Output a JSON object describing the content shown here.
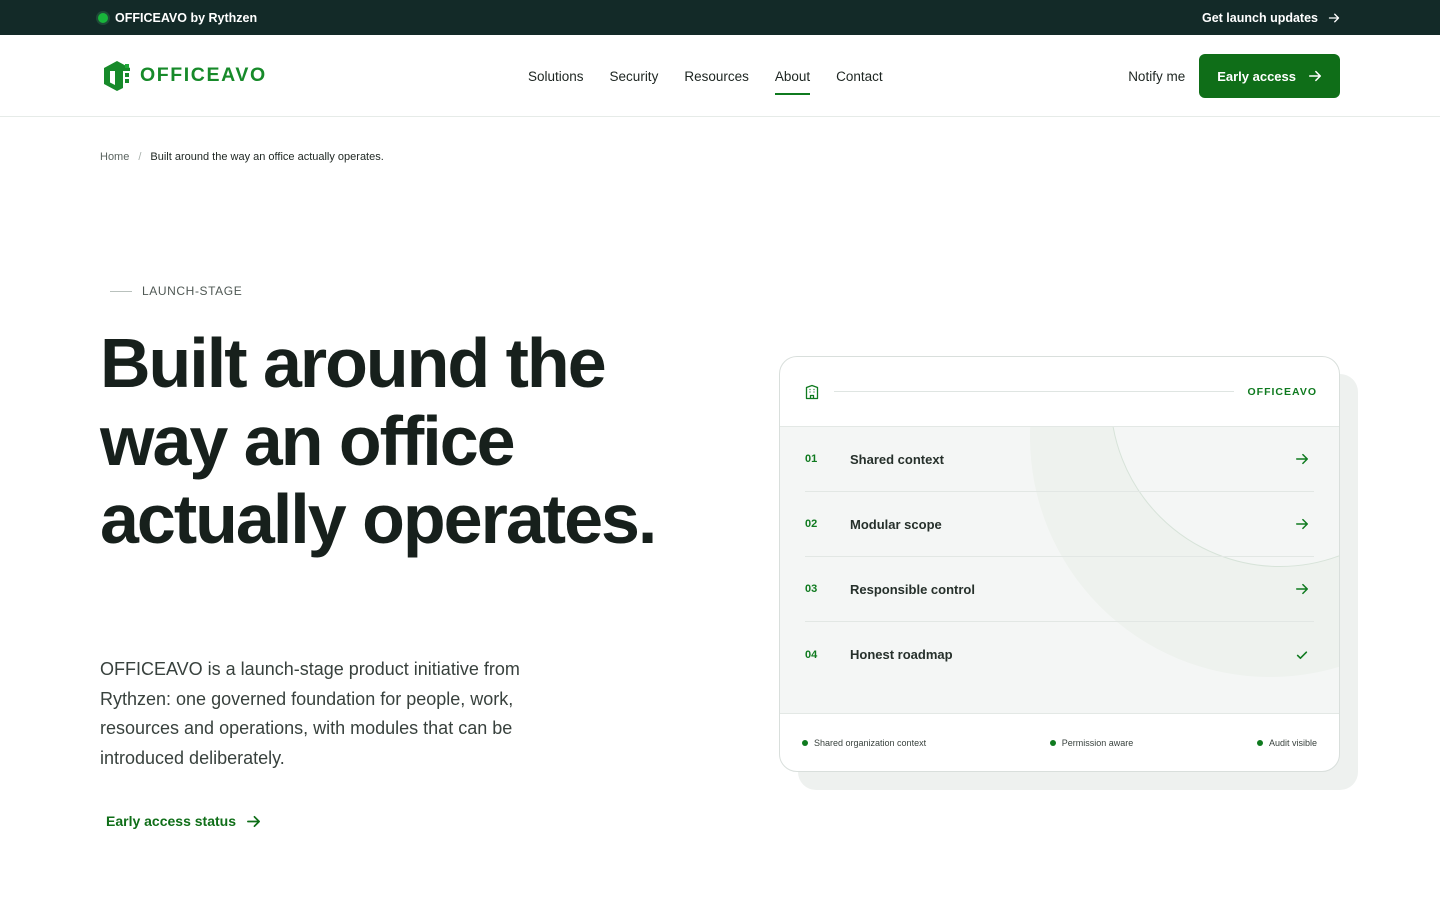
{
  "topbar": {
    "brand": "OFFICEAVO by Rythzen",
    "updates": "Get launch updates"
  },
  "header": {
    "logo_text": "OFFICEAVO",
    "nav": [
      {
        "label": "Solutions",
        "active": false
      },
      {
        "label": "Security",
        "active": false
      },
      {
        "label": "Resources",
        "active": false
      },
      {
        "label": "About",
        "active": true
      },
      {
        "label": "Contact",
        "active": false
      }
    ],
    "notify": "Notify me",
    "cta": "Early access"
  },
  "breadcrumb": {
    "home": "Home",
    "separator": "/",
    "current": "Built around the way an office actually operates."
  },
  "hero": {
    "eyebrow": "LAUNCH-STAGE",
    "title": "Built around the way an office actually operates.",
    "description": "OFFICEAVO is a launch-stage product initiative from Rythzen: one governed foundation for people, work, resources and operations, with modules that can be introduced deliberately.",
    "status_link": "Early access status"
  },
  "card": {
    "tag": "OFFICEAVO",
    "rows": [
      {
        "num": "01",
        "label": "Shared context",
        "icon": "arrow-right-icon"
      },
      {
        "num": "02",
        "label": "Modular scope",
        "icon": "arrow-right-icon"
      },
      {
        "num": "03",
        "label": "Responsible control",
        "icon": "arrow-right-icon"
      },
      {
        "num": "04",
        "label": "Honest roadmap",
        "icon": "check-icon"
      }
    ],
    "footer": [
      "Shared organization context",
      "Permission aware",
      "Audit visible"
    ]
  },
  "colors": {
    "accent": "#0f6e18",
    "topbar": "#132a28",
    "status_dot": "#18b53b"
  }
}
